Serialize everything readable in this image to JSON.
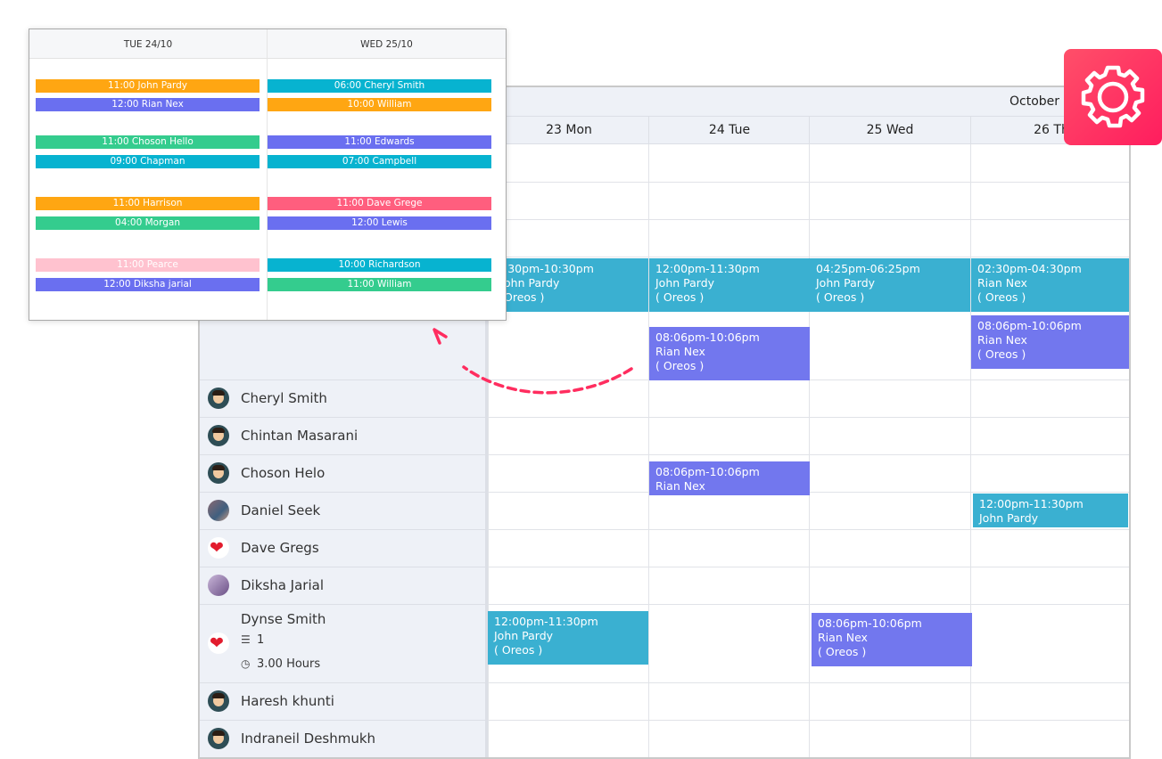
{
  "calendar": {
    "month_label": "October 2",
    "days": [
      "23 Mon",
      "24 Tue",
      "25 Wed",
      "26 Th"
    ]
  },
  "employees": [
    {
      "name": "Cheryl Smith",
      "avatar": "avatar-icon"
    },
    {
      "name": "Chintan Masarani",
      "avatar": "avatar-icon"
    },
    {
      "name": "Choson Helo",
      "avatar": "avatar-icon"
    },
    {
      "name": "Daniel Seek",
      "avatar": "photo-avatar"
    },
    {
      "name": "Dave Gregs",
      "avatar": "heart-icon"
    },
    {
      "name": "Diksha Jarial",
      "avatar": "photo-avatar"
    },
    {
      "name": "Dynse Smith",
      "avatar": "heart-icon",
      "task_count": "1",
      "hours": "3.00 Hours"
    },
    {
      "name": "Haresh khunti",
      "avatar": "avatar-icon"
    },
    {
      "name": "Indraneil Deshmukh",
      "avatar": "avatar-icon"
    }
  ],
  "events": [
    {
      "time": ":30pm-10:30pm",
      "person": "ohn Pardy",
      "note": "Oreos )"
    },
    {
      "time": "12:00pm-11:30pm",
      "person": "John Pardy",
      "note": "( Oreos )"
    },
    {
      "time": "04:25pm-06:25pm",
      "person": "John Pardy",
      "note": "( Oreos )"
    },
    {
      "time": "02:30pm-04:30pm",
      "person": "Rian Nex",
      "note": "( Oreos )"
    },
    {
      "time": "08:06pm-10:06pm",
      "person": "Rian Nex",
      "note": "( Oreos )"
    },
    {
      "time": "08:06pm-10:06pm",
      "person": "Rian Nex",
      "note": "( Oreos )"
    },
    {
      "time": "08:06pm-10:06pm",
      "person": "Rian Nex"
    },
    {
      "time": "12:00pm-11:30pm",
      "person": "John Pardy"
    },
    {
      "time": "12:00pm-11:30pm",
      "person": "John Pardy",
      "note": "( Oreos )"
    },
    {
      "time": "08:06pm-10:06pm",
      "person": "Rian Nex",
      "note": "( Oreos )"
    }
  ],
  "popup": {
    "headers": [
      "TUE 24/10",
      "WED 25/10"
    ],
    "tue": [
      "11:00 John Pardy",
      "12:00 Rian Nex",
      "11:00 Choson Hello",
      "09:00  Chapman",
      "11:00  Harrison",
      "04:00 Morgan",
      "11:00  Pearce",
      "12:00 Diksha jarial"
    ],
    "wed": [
      "06:00 Cheryl Smith",
      "10:00 William",
      "11:00 Edwards",
      "07:00 Campbell",
      "11:00 Dave Grege",
      "12:00 Lewis",
      "10:00 Richardson",
      "11:00 William"
    ]
  },
  "colors": {
    "event_teal": "#3ab0d1",
    "event_blue": "#7277ee",
    "badge_red": "#ff2d5f",
    "arrow_red": "#ff2d5f"
  },
  "icons": {
    "badge": "gear-icon",
    "task": "list-icon",
    "hours": "clock-icon",
    "arrow": "curved-arrow-icon"
  }
}
